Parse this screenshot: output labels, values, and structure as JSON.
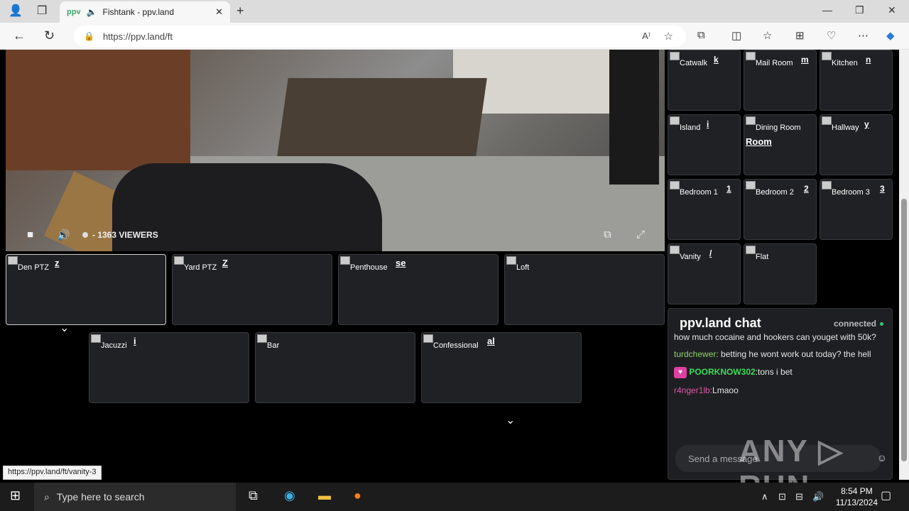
{
  "browser": {
    "tab_title": "Fishtank - ppv.land",
    "favicon": "ppv",
    "url": "https://ppv.land/ft",
    "new_tab": "+",
    "minimize": "—",
    "restore": "❐",
    "close": "✕"
  },
  "player": {
    "viewers": "- 1363 VIEWERS"
  },
  "cameras_main": [
    {
      "label": "Den PTZ",
      "overlay": "z"
    },
    {
      "label": "Yard PTZ",
      "overlay": "Z"
    },
    {
      "label": "Penthouse",
      "overlay": "se"
    },
    {
      "label": "Loft",
      "overlay": ""
    },
    {
      "label": "Jacuzzi",
      "overlay": "i"
    },
    {
      "label": "Bar",
      "overlay": ""
    },
    {
      "label": "Confessional",
      "overlay": "al"
    }
  ],
  "cameras_side": [
    {
      "label": "Catwalk",
      "overlay": "k"
    },
    {
      "label": "Mail Room",
      "overlay": "m"
    },
    {
      "label": "Kitchen",
      "overlay": "n"
    },
    {
      "label": "Island",
      "overlay": "i"
    },
    {
      "label": "Dining Room",
      "overlay": "Room"
    },
    {
      "label": "Hallway",
      "overlay": "y"
    },
    {
      "label": "Bedroom 1",
      "overlay": "1"
    },
    {
      "label": "Bedroom 2",
      "overlay": "2"
    },
    {
      "label": "Bedroom 3",
      "overlay": "3"
    },
    {
      "label": "Vanity",
      "overlay": "/"
    },
    {
      "label": "Flat",
      "overlay": ""
    }
  ],
  "chat": {
    "title": "ppv.land chat",
    "status": "connected",
    "messages": [
      {
        "user": "",
        "text": "how much cocaine and hookers can youget with 50k?",
        "color": "#b07ae0"
      },
      {
        "user": "turdchewer:",
        "text": "betting he wont work out today? the hell",
        "color": "#8fd16a"
      },
      {
        "user": "POORKNOW302",
        "text": ":tons i bet",
        "color": "#3cdc5a"
      },
      {
        "user": "r4nger1lb:",
        "text": "Lmaoo",
        "color": "#e058a8"
      }
    ],
    "placeholder": "Send a message"
  },
  "status_url": "https://ppv.land/ft/vanity-3",
  "watermark": "ANY ▷ RUN",
  "taskbar": {
    "search_placeholder": "Type here to search",
    "time": "8:54 PM",
    "date": "11/13/2024"
  }
}
